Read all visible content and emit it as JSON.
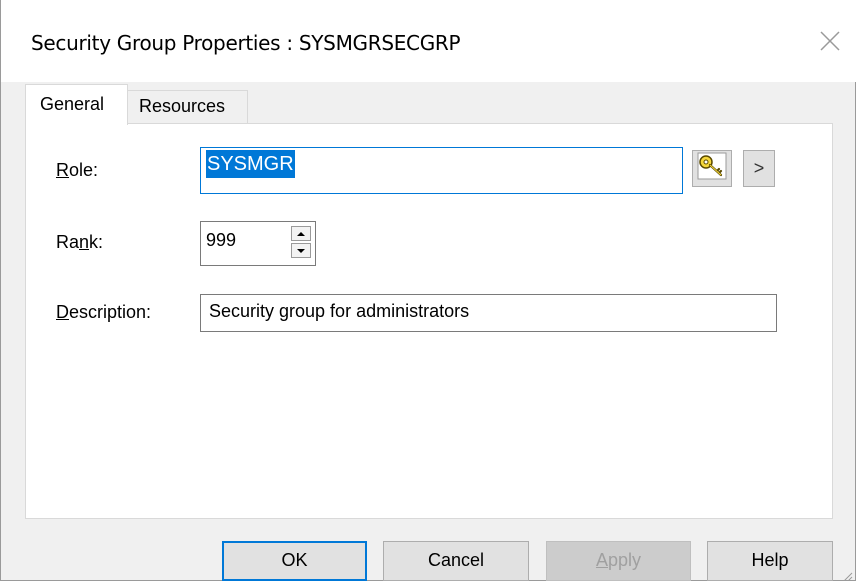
{
  "window": {
    "title": "Security Group Properties : SYSMGRSECGRP"
  },
  "tabs": [
    {
      "label": "General",
      "active": true
    },
    {
      "label": "Resources",
      "active": false
    }
  ],
  "form": {
    "role": {
      "label_mnemonic": "R",
      "label_rest": "ole:",
      "value": "SYSMGR",
      "selected": true
    },
    "rank": {
      "label_start": "Ra",
      "label_mnemonic": "n",
      "label_rest": "k:",
      "value": "999"
    },
    "description": {
      "label_mnemonic": "D",
      "label_rest": "escription:",
      "value": "Security group for administrators"
    },
    "lookup_icon": "key-icon",
    "more_button_label": ">"
  },
  "buttons": {
    "ok": "OK",
    "cancel": "Cancel",
    "apply_mnemonic": "A",
    "apply_rest": "pply",
    "help": "Help"
  },
  "colors": {
    "accent": "#0078d7",
    "selection_text": "#ffffff",
    "disabled_text": "#a0a0a0"
  }
}
